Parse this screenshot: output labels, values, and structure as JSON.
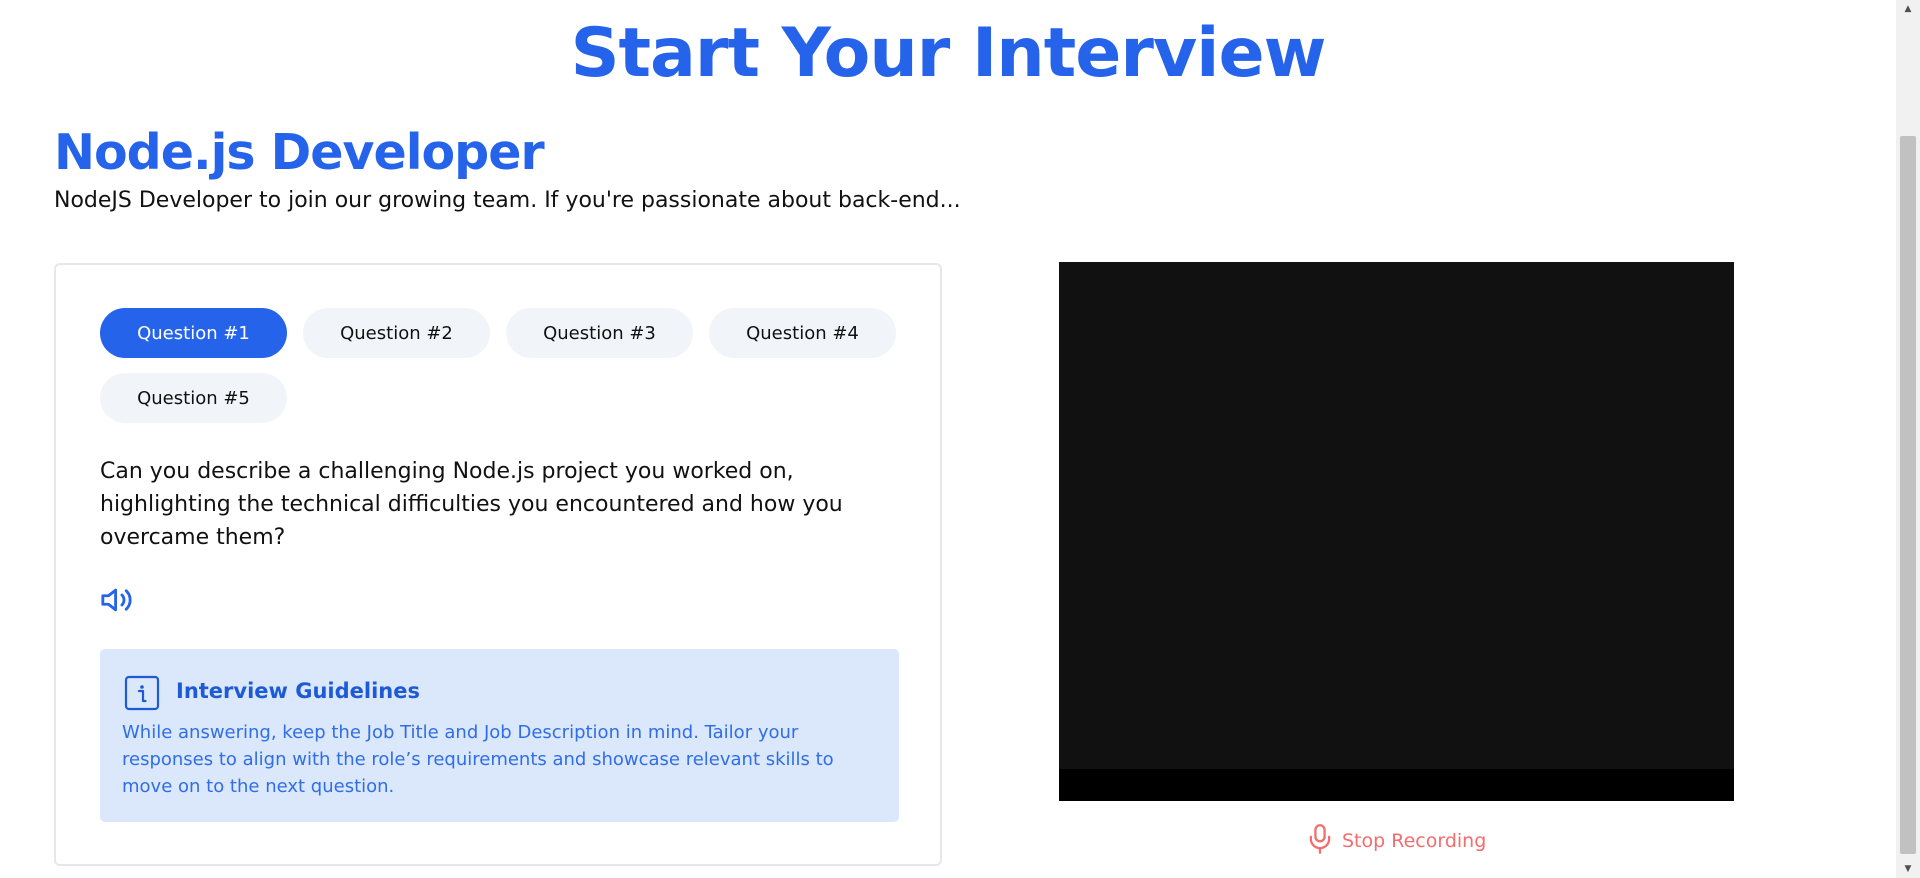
{
  "header": {
    "title": "Start Your Interview"
  },
  "job": {
    "title": "Node.js Developer",
    "description": "NodeJS Developer to join our growing team. If you're passionate about back-end..."
  },
  "questions": {
    "tabs": [
      {
        "label": "Question #1",
        "active": true
      },
      {
        "label": "Question #2",
        "active": false
      },
      {
        "label": "Question #3",
        "active": false
      },
      {
        "label": "Question #4",
        "active": false
      },
      {
        "label": "Question #5",
        "active": false
      }
    ],
    "current_text": "Can you describe a challenging Node.js project you worked on, highlighting the technical difficulties you encountered and how you overcame them?",
    "speaker_icon": "volume-icon"
  },
  "guidelines": {
    "icon": "info-icon",
    "title": "Interview Guidelines",
    "body": "While answering, keep the Job Title and Job Description in mind. Tailor your responses to align with the role’s requirements and showcase relevant skills to move on to the next question."
  },
  "recording": {
    "icon": "microphone-icon",
    "label": "Stop Recording"
  },
  "colors": {
    "accent": "#2563eb",
    "tab_inactive": "#f1f5f9",
    "guidelines_bg": "#dbe7fb",
    "stop_recording": "#f26d6d",
    "video_bg": "#111111"
  }
}
